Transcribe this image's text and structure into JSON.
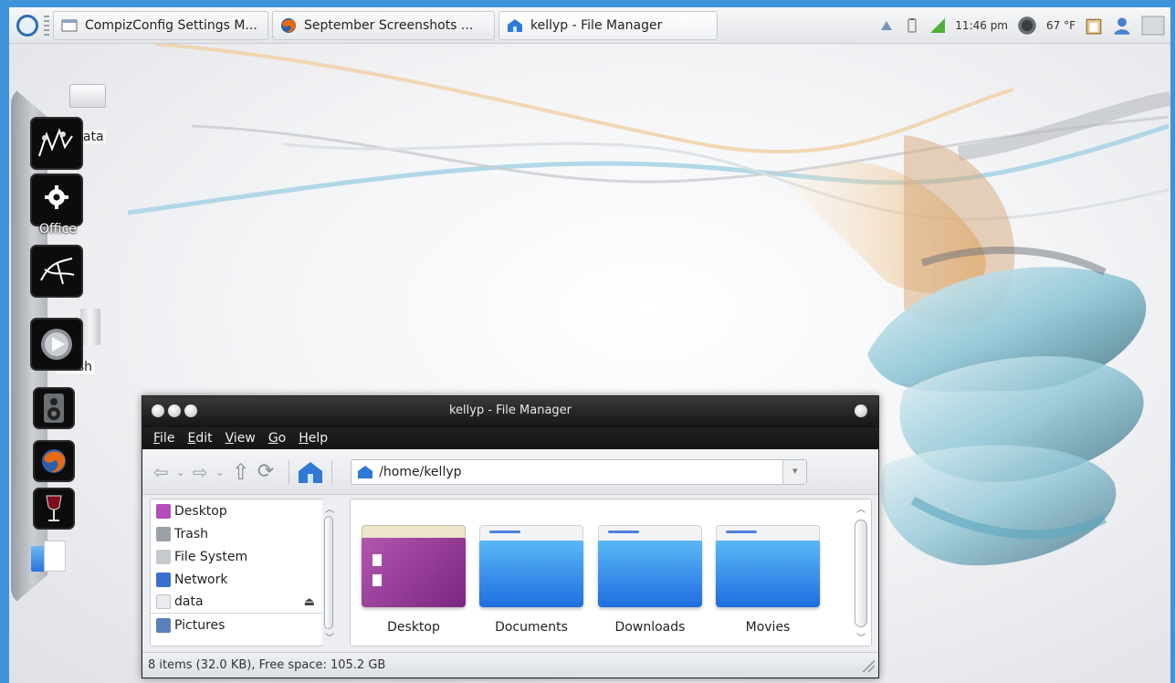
{
  "taskbar": {
    "tasks": [
      {
        "label": "CompizConfig Settings M..."
      },
      {
        "label": "September Screenshots ..."
      },
      {
        "label": "kellyp - File Manager"
      }
    ],
    "clock": "11:46 pm",
    "weather": "67 °F"
  },
  "desktop": {
    "icons": [
      {
        "label": "data"
      },
      {
        "label": "Trash"
      }
    ]
  },
  "dock": {
    "items": [
      {
        "icon": "gimp-icon"
      },
      {
        "icon": "office-gear-icon",
        "label": "Office"
      },
      {
        "icon": "inkscape-icon"
      },
      {
        "icon": "media-player-icon"
      },
      {
        "icon": "speaker-icon"
      },
      {
        "icon": "firefox-icon"
      },
      {
        "icon": "wine-glass-icon"
      },
      {
        "icon": "file-manager-icon"
      }
    ]
  },
  "file_manager": {
    "title": "kellyp - File Manager",
    "menu": [
      "File",
      "Edit",
      "View",
      "Go",
      "Help"
    ],
    "location": "/home/kellyp",
    "places": [
      {
        "label": "Desktop",
        "color": "#b44dba"
      },
      {
        "label": "Trash",
        "color": "#9aa0a8"
      },
      {
        "label": "File System",
        "color": "#c6c9ce"
      },
      {
        "label": "Network",
        "color": "#3a6fd0"
      },
      {
        "label": "data",
        "color": "#e9ebee"
      },
      {
        "label": "Pictures",
        "color": "#5b7fb8"
      }
    ],
    "files": [
      {
        "label": "Desktop"
      },
      {
        "label": "Documents"
      },
      {
        "label": "Downloads"
      },
      {
        "label": "Movies"
      }
    ],
    "status": "8 items (32.0 KB), Free space: 105.2 GB"
  }
}
